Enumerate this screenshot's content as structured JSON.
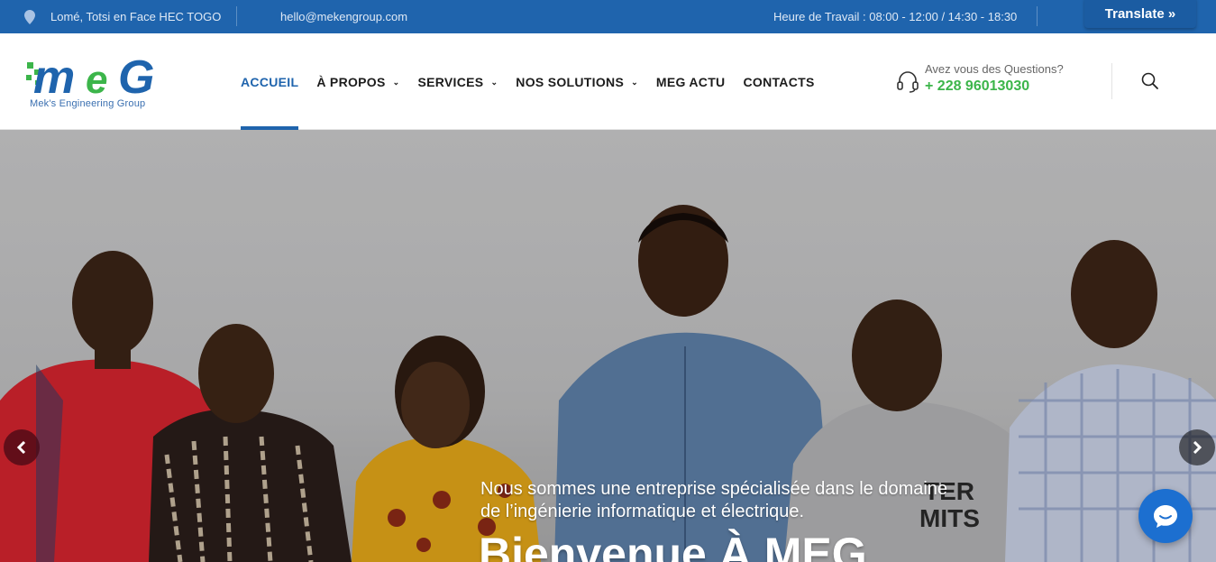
{
  "topbar": {
    "address": "Lomé, Totsi en Face HEC TOGO",
    "email": "hello@mekengroup.com",
    "hours": "Heure de Travail : 08:00 - 12:00 / 14:30 - 18:30",
    "translate_label": "Translate »",
    "background": "#1f64ad"
  },
  "logo": {
    "text": "mEG",
    "tagline": "Mek's Engineering Group"
  },
  "nav": {
    "items": [
      {
        "label": "ACCUEIL",
        "active": true
      },
      {
        "label": "À PROPOS",
        "dropdown": true
      },
      {
        "label": "SERVICES",
        "dropdown": true
      },
      {
        "label": "NOS SOLUTIONS",
        "dropdown": true
      },
      {
        "label": "MEG ACTU"
      },
      {
        "label": "CONTACTS"
      }
    ],
    "active_color": "#1f64ad"
  },
  "contact": {
    "question": "Avez vous des Questions?",
    "phone": "+ 228 96013030",
    "phone_color": "#3cb54a",
    "icon": "headset-icon"
  },
  "search": {
    "icon": "search-icon"
  },
  "hero": {
    "subtitle": "Nous sommes une entreprise spécialisée dans le domaine de l’ingénierie informatique et électrique.",
    "title": "Bienvenue À MEG",
    "prev_icon": "chevron-left-icon",
    "next_icon": "chevron-right-icon"
  },
  "chat": {
    "icon": "chat-icon",
    "color": "#1c6fd0"
  }
}
